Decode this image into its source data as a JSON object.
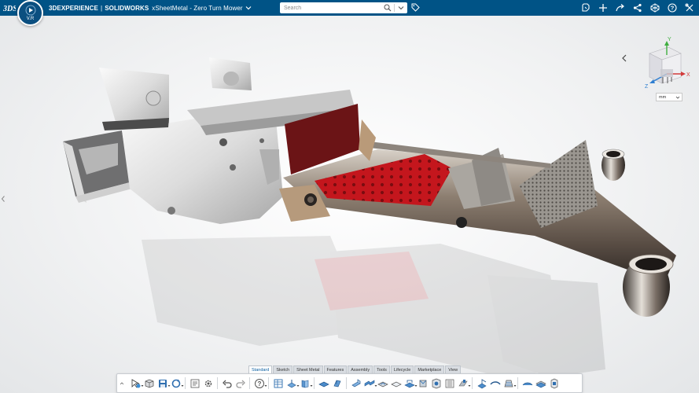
{
  "header": {
    "version": "V.R",
    "brand": "3DEXPERIENCE",
    "separator": "|",
    "product": "SOLIDWORKS",
    "document": "xSheetMetal - Zero Turn Mower",
    "search_placeholder": "Search"
  },
  "viewport": {
    "units": "mm",
    "triad": {
      "x": "X",
      "y": "Y",
      "z": "Z"
    }
  },
  "action_bar": {
    "tabs": [
      {
        "label": "Standard",
        "active": true
      },
      {
        "label": "Sketch",
        "active": false
      },
      {
        "label": "Sheet Metal",
        "active": false
      },
      {
        "label": "Features",
        "active": false
      },
      {
        "label": "Assembly",
        "active": false
      },
      {
        "label": "Tools",
        "active": false
      },
      {
        "label": "Lifecycle",
        "active": false
      },
      {
        "label": "Marketplace",
        "active": false
      },
      {
        "label": "View",
        "active": false
      }
    ]
  },
  "colors": {
    "topbar": "#005386",
    "accent": "#0b5fa1",
    "floor_panel": "#a51820",
    "side_panel": "#6b1416"
  }
}
